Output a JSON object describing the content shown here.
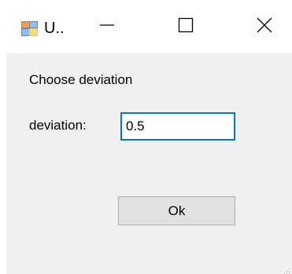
{
  "window": {
    "title": "U..",
    "icon": "winforms-app-icon",
    "controls": {
      "minimize_icon": "minimize-icon",
      "maximize_icon": "maximize-icon",
      "close_icon": "close-icon"
    }
  },
  "dialog": {
    "prompt": "Choose deviation",
    "deviation_label": "deviation:",
    "deviation_value": "0.5",
    "ok_label": "Ok"
  },
  "colors": {
    "client_background": "#f0f0f0",
    "input_focus_border": "#0078d7",
    "button_face": "#e1e1e1"
  }
}
